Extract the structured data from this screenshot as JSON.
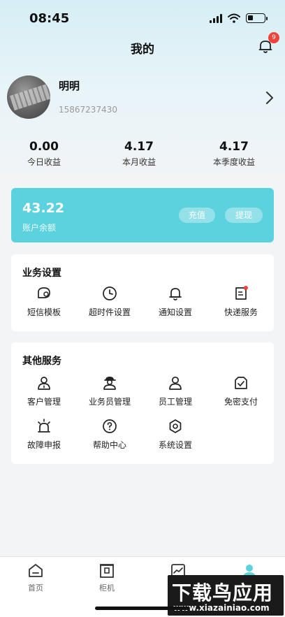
{
  "status_bar": {
    "time": "08:45"
  },
  "header": {
    "title": "我的",
    "notification_count": "9"
  },
  "profile": {
    "name": "明明",
    "phone": "15867237430"
  },
  "stats": [
    {
      "value": "0.00",
      "label": "今日收益"
    },
    {
      "value": "4.17",
      "label": "本月收益"
    },
    {
      "value": "4.17",
      "label": "本季度收益"
    }
  ],
  "balance": {
    "amount": "43.22",
    "label": "账户余额",
    "recharge_label": "充值",
    "withdraw_label": "提现"
  },
  "business_settings": {
    "title": "业务设置",
    "items": [
      {
        "label": "短信模板",
        "icon": "sms-template-icon"
      },
      {
        "label": "超时件设置",
        "icon": "clock-icon"
      },
      {
        "label": "通知设置",
        "icon": "bell-icon"
      },
      {
        "label": "快递服务",
        "icon": "document-icon"
      }
    ]
  },
  "other_services": {
    "title": "其他服务",
    "items": [
      {
        "label": "客户管理",
        "icon": "customer-icon"
      },
      {
        "label": "业务员管理",
        "icon": "courier-icon"
      },
      {
        "label": "员工管理",
        "icon": "staff-icon"
      },
      {
        "label": "免密支付",
        "icon": "payment-icon"
      },
      {
        "label": "故障申报",
        "icon": "alarm-icon"
      },
      {
        "label": "帮助中心",
        "icon": "help-icon"
      },
      {
        "label": "系统设置",
        "icon": "settings-icon"
      }
    ]
  },
  "tabbar": {
    "items": [
      {
        "label": "首页",
        "icon": "home-icon"
      },
      {
        "label": "柜机",
        "icon": "cabinet-icon"
      },
      {
        "label": "",
        "icon": "chart-icon"
      },
      {
        "label": "",
        "icon": "profile-icon"
      }
    ]
  },
  "watermark": {
    "main": "下载鸟应用",
    "sub": "www.xiazainiao.com"
  },
  "colors": {
    "accent": "#5bd2de",
    "badge": "#f0443a",
    "background": "#f3f4f6"
  }
}
